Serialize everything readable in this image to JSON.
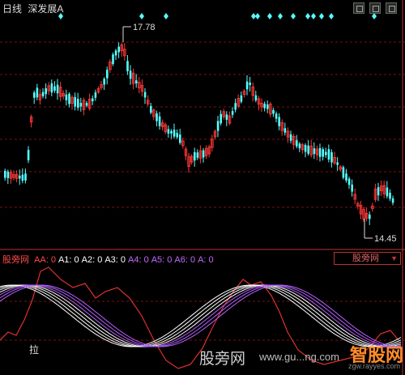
{
  "header": {
    "period": "日线",
    "stock_name": "深发展A"
  },
  "price_panel": {
    "high_label": "17.78",
    "low_label": "14.45"
  },
  "indicator": {
    "name": "股旁网",
    "values": [
      {
        "label": "AA:",
        "value": "0",
        "color": "#ff4a4a"
      },
      {
        "label": "A1:",
        "value": "0",
        "color": "#ffffff"
      },
      {
        "label": "A2:",
        "value": "0",
        "color": "#ffffff"
      },
      {
        "label": "A3:",
        "value": "0",
        "color": "#ffffff"
      },
      {
        "label": "A4:",
        "value": "0",
        "color": "#c06cff"
      },
      {
        "label": "A5:",
        "value": "0",
        "color": "#c06cff"
      },
      {
        "label": "A6:",
        "value": "0",
        "color": "#c06cff"
      },
      {
        "label": "A:",
        "value": "0",
        "color": "#c06cff"
      }
    ],
    "selector_label": "股旁网",
    "marker_text": "拉"
  },
  "watermarks": {
    "site_cn": "股旁网",
    "site_url": "www.gu...ng.com",
    "brand": "智股网",
    "brand_url": "zgw.rayyes.com"
  },
  "colors": {
    "up": "#ff3838",
    "down": "#54ffff",
    "grid": "#7a1010",
    "diamond": "#54ffff"
  }
}
